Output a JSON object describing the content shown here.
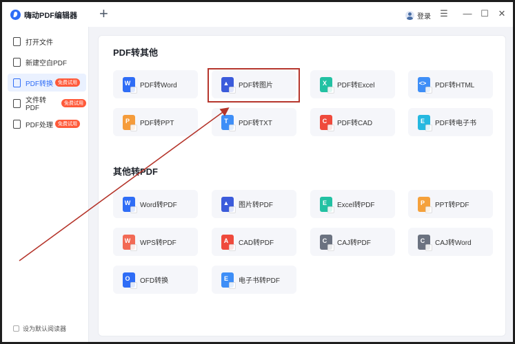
{
  "app": {
    "title": "嗨动PDF编辑器",
    "new_tab": "+"
  },
  "header": {
    "login": "登录",
    "menu": "☰",
    "minimize": "—",
    "maximize": "☐",
    "close": "✕"
  },
  "sidebar": {
    "items": [
      {
        "label": "打开文件",
        "badge": ""
      },
      {
        "label": "新建空白PDF",
        "badge": ""
      },
      {
        "label": "PDF转换",
        "badge": "免费试用"
      },
      {
        "label": "文件转PDF",
        "badge": "免费试用"
      },
      {
        "label": "PDF处理",
        "badge": "免费试用"
      }
    ],
    "default_reader": "设为默认阅读器"
  },
  "sections": [
    {
      "title": "PDF转其他",
      "items": [
        {
          "label": "PDF转Word",
          "icon": "pdf-to-word-icon",
          "color": "#2f6df6",
          "glyph": "W"
        },
        {
          "label": "PDF转图片",
          "icon": "pdf-to-image-icon",
          "color": "#3b5bdb",
          "glyph": "▲"
        },
        {
          "label": "PDF转Excel",
          "icon": "pdf-to-excel-icon",
          "color": "#22c1a3",
          "glyph": "X"
        },
        {
          "label": "PDF转HTML",
          "icon": "pdf-to-html-icon",
          "color": "#3e8ef7",
          "glyph": "<>"
        },
        {
          "label": "PDF转PPT",
          "icon": "pdf-to-ppt-icon",
          "color": "#f59c3b",
          "glyph": "P"
        },
        {
          "label": "PDF转TXT",
          "icon": "pdf-to-txt-icon",
          "color": "#3e8ef7",
          "glyph": "T"
        },
        {
          "label": "PDF转CAD",
          "icon": "pdf-to-cad-icon",
          "color": "#ef4a3c",
          "glyph": "C"
        },
        {
          "label": "PDF转电子书",
          "icon": "pdf-to-ebook-icon",
          "color": "#25b8e0",
          "glyph": "E"
        }
      ]
    },
    {
      "title": "其他转PDF",
      "items": [
        {
          "label": "Word转PDF",
          "icon": "word-to-pdf-icon",
          "color": "#2f6df6",
          "glyph": "W"
        },
        {
          "label": "图片转PDF",
          "icon": "image-to-pdf-icon",
          "color": "#3b5bdb",
          "glyph": "▲"
        },
        {
          "label": "Excel转PDF",
          "icon": "excel-to-pdf-icon",
          "color": "#22c1a3",
          "glyph": "E"
        },
        {
          "label": "PPT转PDF",
          "icon": "ppt-to-pdf-icon",
          "color": "#f5a13b",
          "glyph": "P"
        },
        {
          "label": "WPS转PDF",
          "icon": "wps-to-pdf-icon",
          "color": "#f26a55",
          "glyph": "W"
        },
        {
          "label": "CAD转PDF",
          "icon": "cad-to-pdf-icon",
          "color": "#ef4a3c",
          "glyph": "A"
        },
        {
          "label": "CAJ转PDF",
          "icon": "caj-to-pdf-icon",
          "color": "#6b7280",
          "glyph": "C"
        },
        {
          "label": "CAJ转Word",
          "icon": "caj-to-word-icon",
          "color": "#6b7280",
          "glyph": "C"
        },
        {
          "label": "OFD转换",
          "icon": "ofd-convert-icon",
          "color": "#2f6df6",
          "glyph": "O"
        },
        {
          "label": "电子书转PDF",
          "icon": "ebook-to-pdf-icon",
          "color": "#3e8ef7",
          "glyph": "E"
        }
      ]
    }
  ],
  "annotation": {
    "highlight_color": "#b5352b"
  }
}
